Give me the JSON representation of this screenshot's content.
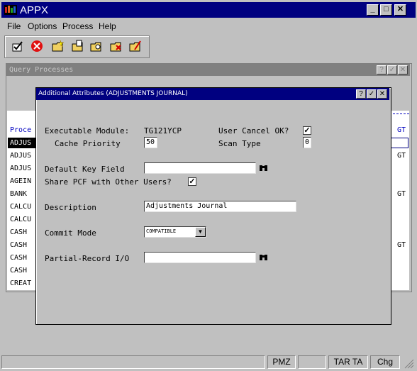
{
  "window": {
    "title": "APPX"
  },
  "menu": [
    "File",
    "Options",
    "Process",
    "Help"
  ],
  "toolbar": [
    "check-icon",
    "cancel-icon",
    "folder-new-icon",
    "folder-open-icon",
    "folder-find-icon",
    "folder-delete-icon",
    "folder-edit-icon"
  ],
  "query_window": {
    "title": "Query Processes",
    "column_header": "Proce",
    "rows": [
      "ADJUS",
      "ADJUS",
      "ADJUS",
      "AGEIN",
      "BANK",
      "CALCU",
      "CALCU",
      "CASH",
      "CASH",
      "CASH",
      "CASH",
      "CREAT"
    ],
    "right_header": "GT",
    "right_values": [
      "GT",
      "GT",
      "GT"
    ]
  },
  "dialog": {
    "title": "Additional Attributes (ADJUSTMENTS JOURNAL)",
    "executable_module_label": "Executable Module:",
    "executable_module_value": "TG121YCP",
    "user_cancel_label": "User Cancel OK?",
    "user_cancel_checked": true,
    "cache_priority_label": "Cache Priority",
    "cache_priority_value": "50",
    "scan_type_label": "Scan Type",
    "scan_type_value": "0",
    "default_key_label": "Default Key Field",
    "default_key_value": "",
    "share_pcf_label": "Share PCF with Other Users?",
    "share_pcf_checked": true,
    "description_label": "Description",
    "description_value": "Adjustments Journal",
    "commit_mode_label": "Commit Mode",
    "commit_mode_value": "COMPATIBLE",
    "partial_record_label": "Partial-Record I/O",
    "partial_record_value": ""
  },
  "statusbar": [
    "PMZ",
    "TAR TA",
    "Chg"
  ]
}
